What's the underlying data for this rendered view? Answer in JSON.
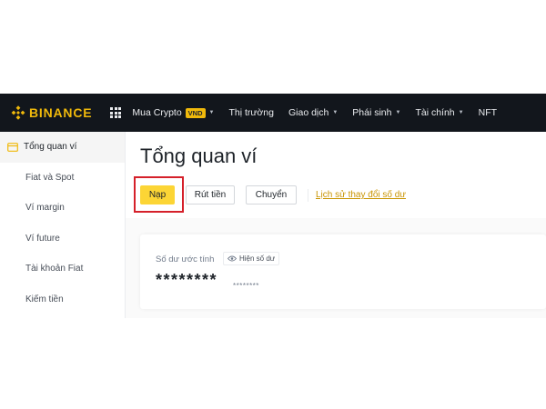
{
  "brand": {
    "name": "BINANCE",
    "color": "#f0b90b"
  },
  "nav": {
    "items": [
      {
        "label": "Mua Crypto",
        "badge": "VND",
        "dropdown": true
      },
      {
        "label": "Thị trường",
        "dropdown": false
      },
      {
        "label": "Giao dịch",
        "dropdown": true
      },
      {
        "label": "Phái sinh",
        "dropdown": true
      },
      {
        "label": "Tài chính",
        "dropdown": true
      },
      {
        "label": "NFT",
        "dropdown": false
      }
    ],
    "caret": "▼"
  },
  "sidebar": {
    "items": [
      {
        "label": "Tổng quan ví",
        "active": true,
        "icon": "wallet-icon"
      },
      {
        "label": "Fiat và Spot"
      },
      {
        "label": "Ví margin"
      },
      {
        "label": "Ví future"
      },
      {
        "label": "Tài khoản Fiat"
      },
      {
        "label": "Kiếm tiền"
      }
    ]
  },
  "main": {
    "title": "Tổng quan ví",
    "buttons": {
      "deposit": "Nạp",
      "withdraw": "Rút tiền",
      "transfer": "Chuyển"
    },
    "history_link": "Lịch sử thay đổi số dư"
  },
  "balance": {
    "label": "Số dư ước tính",
    "show_label": "Hiện số dư",
    "masked_value": "********",
    "masked_sub": "********"
  },
  "colors": {
    "accent": "#fcd535",
    "link": "#c99400",
    "highlight": "#d5202a",
    "topbar": "#12161c"
  }
}
